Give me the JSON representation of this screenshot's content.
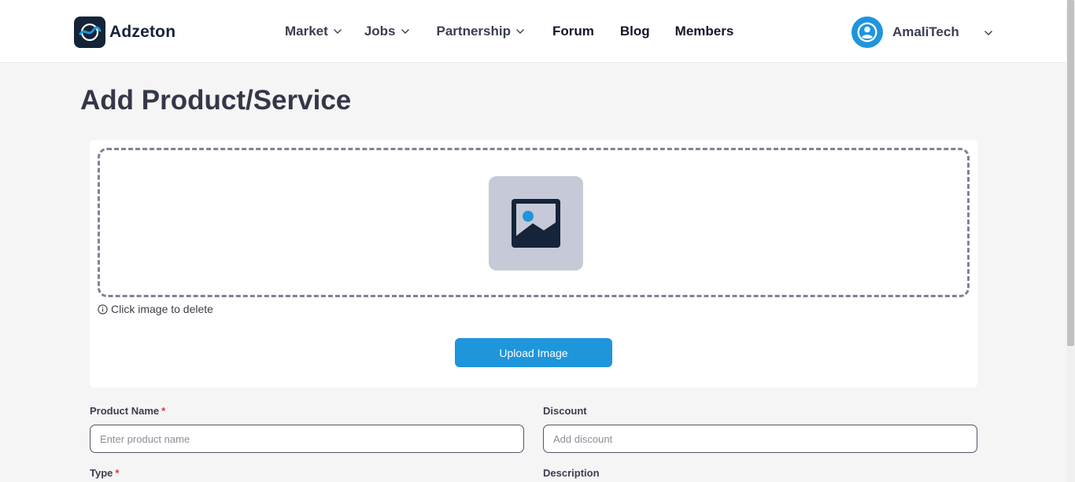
{
  "header": {
    "brand": "Adzeton",
    "nav": [
      {
        "label": "Market",
        "has_dropdown": true
      },
      {
        "label": "Jobs",
        "has_dropdown": true
      },
      {
        "label": "Partnership",
        "has_dropdown": true
      },
      {
        "label": "Forum",
        "has_dropdown": false
      },
      {
        "label": "Blog",
        "has_dropdown": false
      },
      {
        "label": "Members",
        "has_dropdown": false
      }
    ],
    "user": {
      "name": "AmaliTech",
      "avatar_icon": "user-circle-icon"
    }
  },
  "page": {
    "title": "Add Product/Service",
    "upload": {
      "placeholder_icon": "image-placeholder-icon",
      "hint": "Click image to delete",
      "hint_icon": "info-circle-icon",
      "button_label": "Upload Image"
    },
    "form": {
      "product_name": {
        "label": "Product Name",
        "required_mark": "*",
        "placeholder": "Enter product name",
        "value": ""
      },
      "discount": {
        "label": "Discount",
        "placeholder": "Add discount",
        "value": ""
      },
      "type": {
        "label": "Type",
        "required_mark": "*"
      },
      "description": {
        "label": "Description"
      }
    }
  },
  "colors": {
    "accent": "#1f95dc",
    "brand_dark": "#152438",
    "required": "#e0353f",
    "page_bg": "#f5f5f5",
    "image_tile": "#c6c9d8"
  }
}
